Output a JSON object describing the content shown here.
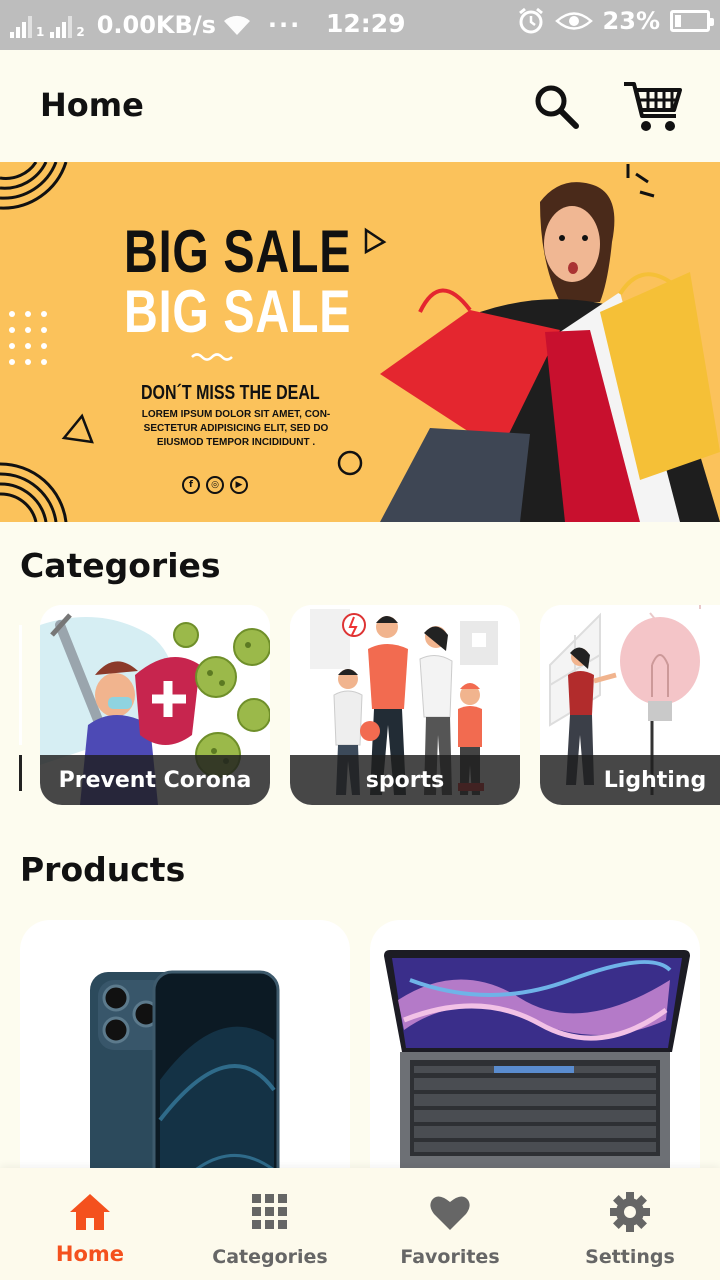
{
  "status_bar": {
    "sim1": "1",
    "sim2": "2",
    "net_speed": "0.00KB/s",
    "more": "···",
    "time": "12:29",
    "battery": "23%"
  },
  "app_bar": {
    "title": "Home",
    "search_icon": "search-icon",
    "cart_icon": "cart-icon"
  },
  "banner": {
    "headline_1": "BIG SALE",
    "headline_2": "BIG SALE",
    "tagline": "DON´T MISS THE DEAL",
    "body": "LOREM IPSUM DOLOR SIT AMET, CON-SECTETUR ADIPISICING ELIT, SED DO EIUSMOD TEMPOR INCIDIDUNT .",
    "social": [
      "f",
      "◎",
      "▶"
    ]
  },
  "categories": {
    "title": "Categories",
    "items": [
      {
        "label": "Prevent Corona"
      },
      {
        "label": "sports"
      },
      {
        "label": "Lighting"
      }
    ]
  },
  "products": {
    "title": "Products",
    "items": [
      {
        "image": "smartphone"
      },
      {
        "image": "laptop"
      }
    ]
  },
  "bottom_nav": {
    "items": [
      {
        "label": "Home",
        "icon": "home-icon",
        "active": true
      },
      {
        "label": "Categories",
        "icon": "grid-icon",
        "active": false
      },
      {
        "label": "Favorites",
        "icon": "heart-icon",
        "active": false
      },
      {
        "label": "Settings",
        "icon": "gear-icon",
        "active": false
      }
    ]
  },
  "colors": {
    "background": "#fdfcef",
    "accent": "#f4511e",
    "banner": "#fbc25b",
    "inactive": "#666666"
  }
}
